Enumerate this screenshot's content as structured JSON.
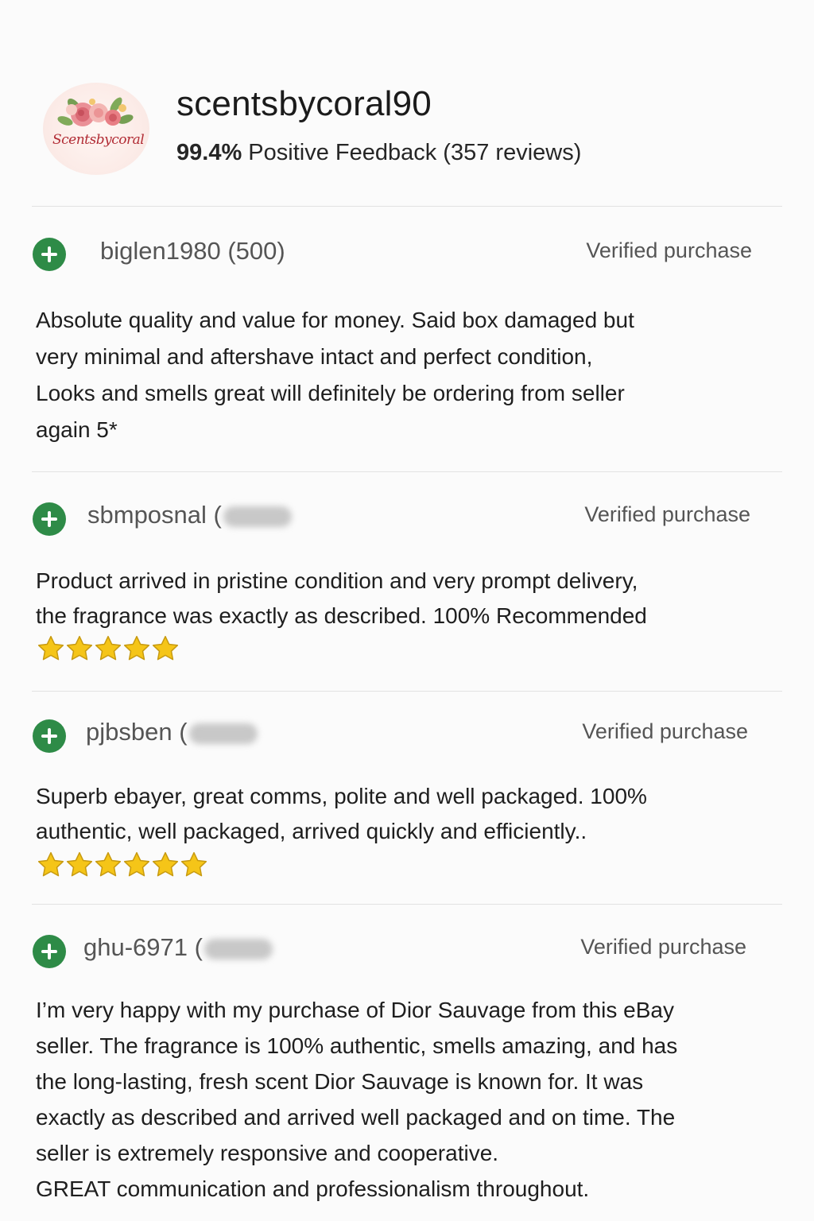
{
  "seller": {
    "name": "scentsbycoral90",
    "logo_text": "Scentsbycoral",
    "positive_pct": "99.4%",
    "feedback_label": "Positive Feedback (357 reviews)"
  },
  "colors": {
    "positive_icon": "#2e8b47",
    "star": "#f5c518"
  },
  "reviews": [
    {
      "reviewer": "biglen1980 (500)",
      "score_hidden": false,
      "badge": "Verified purchase",
      "text": "Absolute quality and value for money. Said box damaged but\nvery minimal and aftershave intact and perfect condition,\nLooks and smells great will definitely be ordering from seller\nagain 5*",
      "stars": 0
    },
    {
      "reviewer": "sbmposnal (",
      "score_hidden": true,
      "badge": "Verified purchase",
      "text": "Product arrived in pristine condition and very prompt delivery,\nthe fragrance was exactly as described. 100% Recommended",
      "stars": 5
    },
    {
      "reviewer": "pjbsben (",
      "score_hidden": true,
      "badge": "Verified purchase",
      "text": "Superb ebayer, great comms, polite and well packaged. 100%\nauthentic, well packaged, arrived quickly and efficiently..",
      "stars": 6
    },
    {
      "reviewer": "ghu-6971 (",
      "score_hidden": true,
      "badge": "Verified purchase",
      "text": "I’m very happy with my purchase of Dior Sauvage from this eBay\nseller. The fragrance is 100% authentic, smells amazing, and has\nthe long-lasting, fresh scent Dior Sauvage is known for. It was\nexactly as described and arrived well packaged and on time. The\nseller is extremely responsive and cooperative.\nGREAT communication and professionalism throughout.",
      "stars": 0
    }
  ]
}
